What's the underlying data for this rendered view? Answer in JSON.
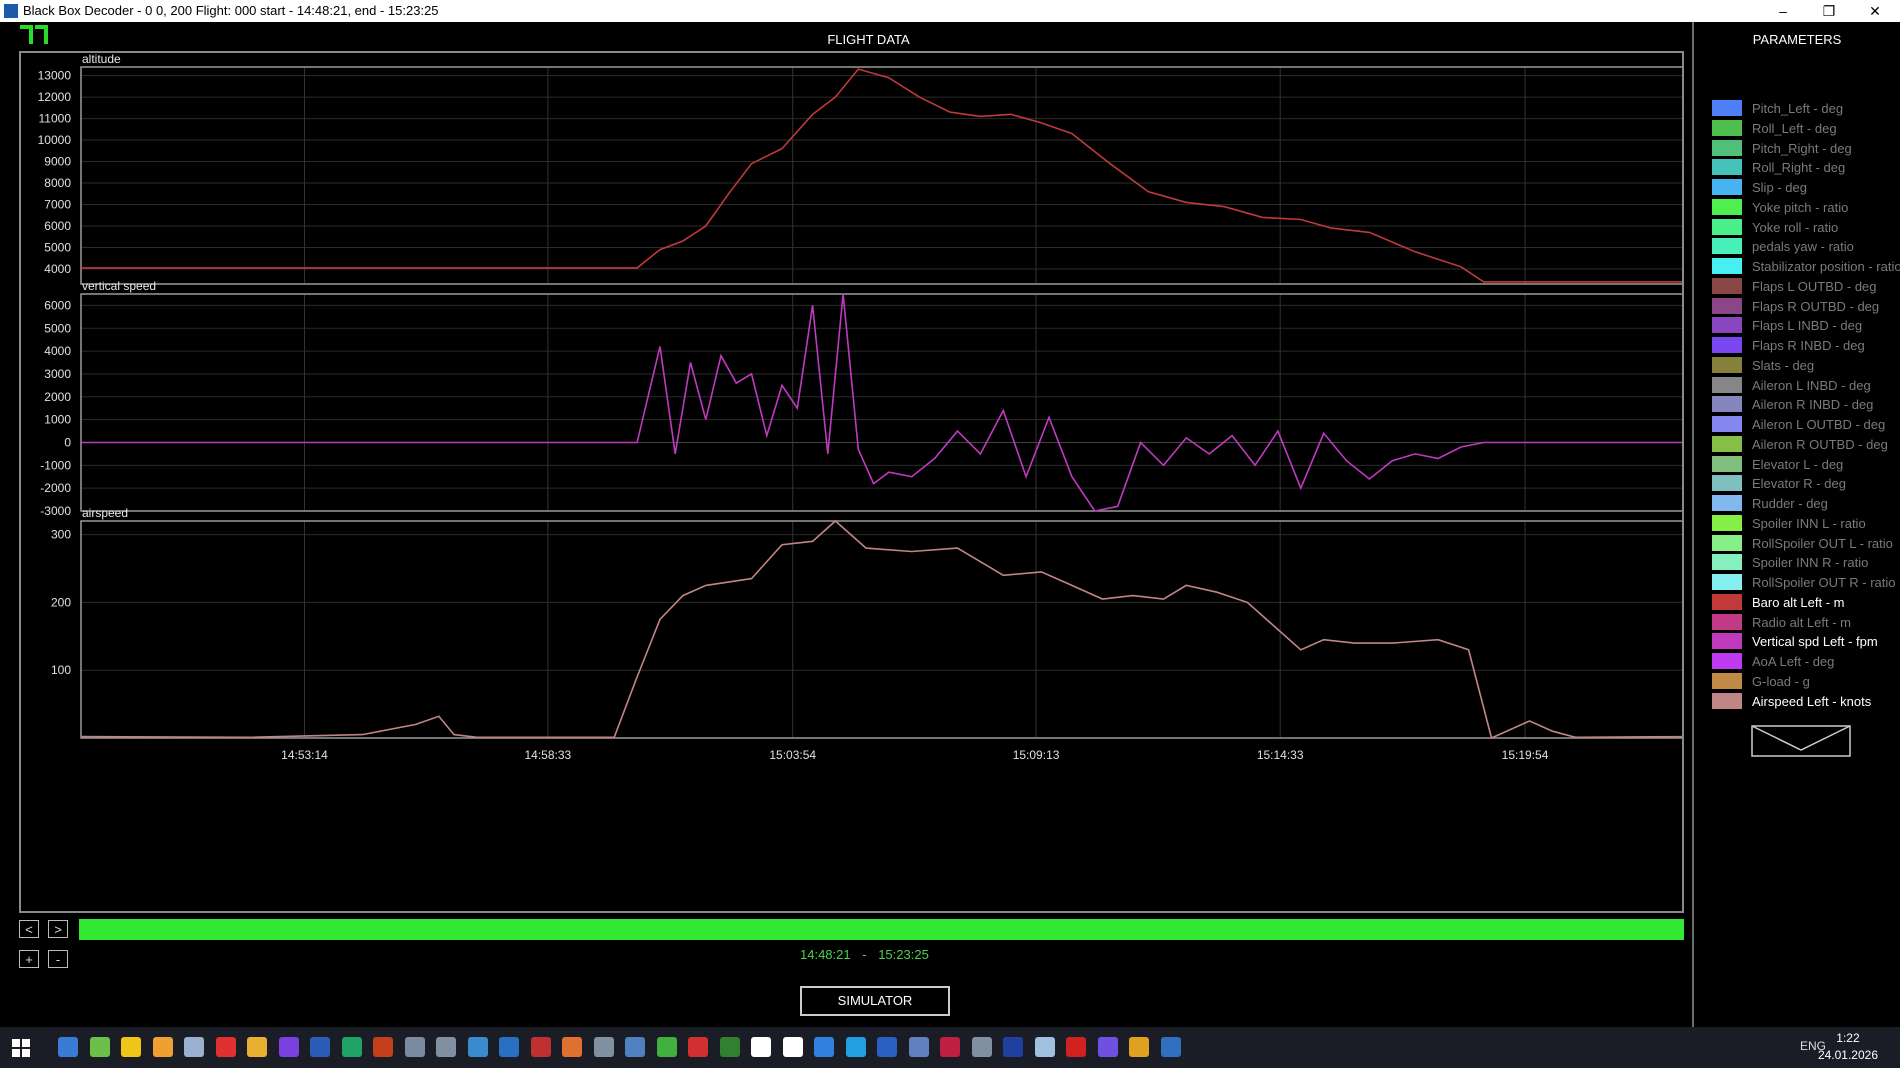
{
  "window": {
    "title": "Black Box Decoder - 0 0, 200  Flight: 000 start - 14:48:21, end - 15:23:25"
  },
  "main": {
    "title": "FLIGHT DATA"
  },
  "nav": {
    "prev": "<",
    "next": ">",
    "zoom_in": "+",
    "zoom_out": "-"
  },
  "time_range": {
    "start": "14:48:21",
    "sep": "-",
    "end": "15:23:25"
  },
  "simulator_button": "SIMULATOR",
  "params_panel": {
    "title": "PARAMETERS",
    "items": [
      {
        "label": "Pitch_Left - deg",
        "color": "#4f7ff7",
        "active": false
      },
      {
        "label": "Roll_Left - deg",
        "color": "#4fbf4f",
        "active": false
      },
      {
        "label": "Pitch_Right - deg",
        "color": "#4fbf7a",
        "active": false
      },
      {
        "label": "Roll_Right - deg",
        "color": "#45c2b8",
        "active": false
      },
      {
        "label": "Slip - deg",
        "color": "#46b4f0",
        "active": false
      },
      {
        "label": "Yoke pitch - ratio",
        "color": "#4fef4f",
        "active": false
      },
      {
        "label": "Yoke roll - ratio",
        "color": "#48ef8a",
        "active": false
      },
      {
        "label": "pedals yaw - ratio",
        "color": "#48efb8",
        "active": false
      },
      {
        "label": "Stabilizator position - ratio",
        "color": "#48eff0",
        "active": false
      },
      {
        "label": "Flaps L OUTBD - deg",
        "color": "#8a4646",
        "active": false
      },
      {
        "label": "Flaps R OUTBD - deg",
        "color": "#8a4686",
        "active": false
      },
      {
        "label": "Flaps L INBD - deg",
        "color": "#8a46bf",
        "active": false
      },
      {
        "label": "Flaps R INBD - deg",
        "color": "#7a46ef",
        "active": false
      },
      {
        "label": "Slats - deg",
        "color": "#86803a",
        "active": false
      },
      {
        "label": "Aileron L INBD - deg",
        "color": "#868686",
        "active": false
      },
      {
        "label": "Aileron R INBD - deg",
        "color": "#8686bf",
        "active": false
      },
      {
        "label": "Aileron L OUTBD - deg",
        "color": "#8686ef",
        "active": false
      },
      {
        "label": "Aileron R OUTBD - deg",
        "color": "#86bf46",
        "active": false
      },
      {
        "label": "Elevator L - deg",
        "color": "#80bf80",
        "active": false
      },
      {
        "label": "Elevator R - deg",
        "color": "#80bfbf",
        "active": false
      },
      {
        "label": "Rudder - deg",
        "color": "#80b8ef",
        "active": false
      },
      {
        "label": "Spoiler INN L - ratio",
        "color": "#86ef46",
        "active": false
      },
      {
        "label": "RollSpoiler OUT L - ratio",
        "color": "#86ef86",
        "active": false
      },
      {
        "label": "Spoiler INN R - ratio",
        "color": "#86efbf",
        "active": false
      },
      {
        "label": "RollSpoiler OUT R - ratio",
        "color": "#86efef",
        "active": false
      },
      {
        "label": "Baro alt Left - m",
        "color": "#c03a3a",
        "active": true
      },
      {
        "label": "Radio alt Left - m",
        "color": "#c03a86",
        "active": false
      },
      {
        "label": "Vertical spd Left - fpm",
        "color": "#c03ac0",
        "active": true
      },
      {
        "label": "AoA Left - deg",
        "color": "#c03aef",
        "active": false
      },
      {
        "label": "G-load - g",
        "color": "#c08a46",
        "active": false
      },
      {
        "label": "Airspeed Left - knots",
        "color": "#c08686",
        "active": true
      }
    ]
  },
  "chart_data": [
    {
      "type": "line",
      "title": "altitude",
      "xlabel": "",
      "ylabel": "",
      "x_ticks": [
        "14:53:14",
        "14:58:33",
        "15:03:54",
        "15:09:13",
        "15:14:33",
        "15:19:54"
      ],
      "y_ticks": [
        4000,
        5000,
        6000,
        7000,
        8000,
        9000,
        10000,
        11000,
        12000,
        13000
      ],
      "ylim": [
        3300,
        13400
      ],
      "series": [
        {
          "color": "#c03a3a",
          "points": [
            [
              "14:48:21",
              4050
            ],
            [
              "15:00:30",
              4050
            ],
            [
              "15:01:00",
              4900
            ],
            [
              "15:01:30",
              5300
            ],
            [
              "15:02:00",
              6000
            ],
            [
              "15:02:30",
              7500
            ],
            [
              "15:03:00",
              8900
            ],
            [
              "15:03:40",
              9600
            ],
            [
              "15:04:20",
              11200
            ],
            [
              "15:04:50",
              12000
            ],
            [
              "15:05:20",
              13300
            ],
            [
              "15:06:00",
              12900
            ],
            [
              "15:06:40",
              12000
            ],
            [
              "15:07:20",
              11300
            ],
            [
              "15:08:00",
              11100
            ],
            [
              "15:08:40",
              11200
            ],
            [
              "15:09:20",
              10800
            ],
            [
              "15:10:00",
              10300
            ],
            [
              "15:10:50",
              8900
            ],
            [
              "15:11:40",
              7600
            ],
            [
              "15:12:30",
              7100
            ],
            [
              "15:13:20",
              6900
            ],
            [
              "15:14:10",
              6400
            ],
            [
              "15:15:00",
              6300
            ],
            [
              "15:15:40",
              5900
            ],
            [
              "15:16:30",
              5700
            ],
            [
              "15:17:30",
              4800
            ],
            [
              "15:18:30",
              4100
            ],
            [
              "15:19:00",
              3400
            ],
            [
              "15:23:25",
              3400
            ]
          ]
        }
      ]
    },
    {
      "type": "line",
      "title": "vertical speed",
      "xlabel": "",
      "ylabel": "",
      "y_ticks": [
        -3000,
        -2000,
        -1000,
        0,
        1000,
        2000,
        3000,
        4000,
        5000,
        6000
      ],
      "ylim": [
        -3000,
        6500
      ],
      "series": [
        {
          "color": "#c03ac0",
          "points": [
            [
              "14:48:21",
              0
            ],
            [
              "15:00:30",
              0
            ],
            [
              "15:01:00",
              4200
            ],
            [
              "15:01:20",
              -500
            ],
            [
              "15:01:40",
              3500
            ],
            [
              "15:02:00",
              1000
            ],
            [
              "15:02:20",
              3800
            ],
            [
              "15:02:40",
              2600
            ],
            [
              "15:03:00",
              3000
            ],
            [
              "15:03:20",
              300
            ],
            [
              "15:03:40",
              2500
            ],
            [
              "15:04:00",
              1500
            ],
            [
              "15:04:20",
              6000
            ],
            [
              "15:04:40",
              -500
            ],
            [
              "15:05:00",
              6500
            ],
            [
              "15:05:20",
              -300
            ],
            [
              "15:05:40",
              -1800
            ],
            [
              "15:06:00",
              -1300
            ],
            [
              "15:06:30",
              -1500
            ],
            [
              "15:07:00",
              -700
            ],
            [
              "15:07:30",
              500
            ],
            [
              "15:08:00",
              -500
            ],
            [
              "15:08:30",
              1400
            ],
            [
              "15:09:00",
              -1500
            ],
            [
              "15:09:30",
              1100
            ],
            [
              "15:10:00",
              -1500
            ],
            [
              "15:10:30",
              -3000
            ],
            [
              "15:11:00",
              -2800
            ],
            [
              "15:11:30",
              0
            ],
            [
              "15:12:00",
              -1000
            ],
            [
              "15:12:30",
              200
            ],
            [
              "15:13:00",
              -500
            ],
            [
              "15:13:30",
              300
            ],
            [
              "15:14:00",
              -1000
            ],
            [
              "15:14:30",
              500
            ],
            [
              "15:15:00",
              -2000
            ],
            [
              "15:15:30",
              400
            ],
            [
              "15:16:00",
              -800
            ],
            [
              "15:16:30",
              -1600
            ],
            [
              "15:17:00",
              -800
            ],
            [
              "15:17:30",
              -500
            ],
            [
              "15:18:00",
              -700
            ],
            [
              "15:18:30",
              -200
            ],
            [
              "15:19:00",
              0
            ],
            [
              "15:23:25",
              0
            ]
          ]
        }
      ]
    },
    {
      "type": "line",
      "title": "airspeed",
      "xlabel": "",
      "ylabel": "",
      "y_ticks": [
        100,
        200,
        300
      ],
      "ylim": [
        0,
        320
      ],
      "series": [
        {
          "color": "#c08686",
          "points": [
            [
              "14:48:21",
              2
            ],
            [
              "14:52:00",
              1
            ],
            [
              "14:54:30",
              5
            ],
            [
              "14:55:40",
              20
            ],
            [
              "14:56:10",
              32
            ],
            [
              "14:56:30",
              5
            ],
            [
              "14:57:00",
              1
            ],
            [
              "15:00:00",
              1
            ],
            [
              "15:00:30",
              90
            ],
            [
              "15:01:00",
              175
            ],
            [
              "15:01:30",
              210
            ],
            [
              "15:02:00",
              225
            ],
            [
              "15:03:00",
              235
            ],
            [
              "15:03:40",
              285
            ],
            [
              "15:04:20",
              290
            ],
            [
              "15:04:50",
              320
            ],
            [
              "15:05:30",
              280
            ],
            [
              "15:06:30",
              275
            ],
            [
              "15:07:30",
              280
            ],
            [
              "15:08:30",
              240
            ],
            [
              "15:09:20",
              245
            ],
            [
              "15:10:00",
              225
            ],
            [
              "15:10:40",
              205
            ],
            [
              "15:11:20",
              210
            ],
            [
              "15:12:00",
              205
            ],
            [
              "15:12:30",
              225
            ],
            [
              "15:13:10",
              215
            ],
            [
              "15:13:50",
              200
            ],
            [
              "15:14:30",
              160
            ],
            [
              "15:15:00",
              130
            ],
            [
              "15:15:30",
              145
            ],
            [
              "15:16:10",
              140
            ],
            [
              "15:17:00",
              140
            ],
            [
              "15:18:00",
              145
            ],
            [
              "15:18:40",
              130
            ],
            [
              "15:19:10",
              0
            ],
            [
              "15:20:00",
              25
            ],
            [
              "15:20:30",
              10
            ],
            [
              "15:21:00",
              1
            ],
            [
              "15:23:25",
              2
            ]
          ]
        }
      ]
    }
  ]
}
